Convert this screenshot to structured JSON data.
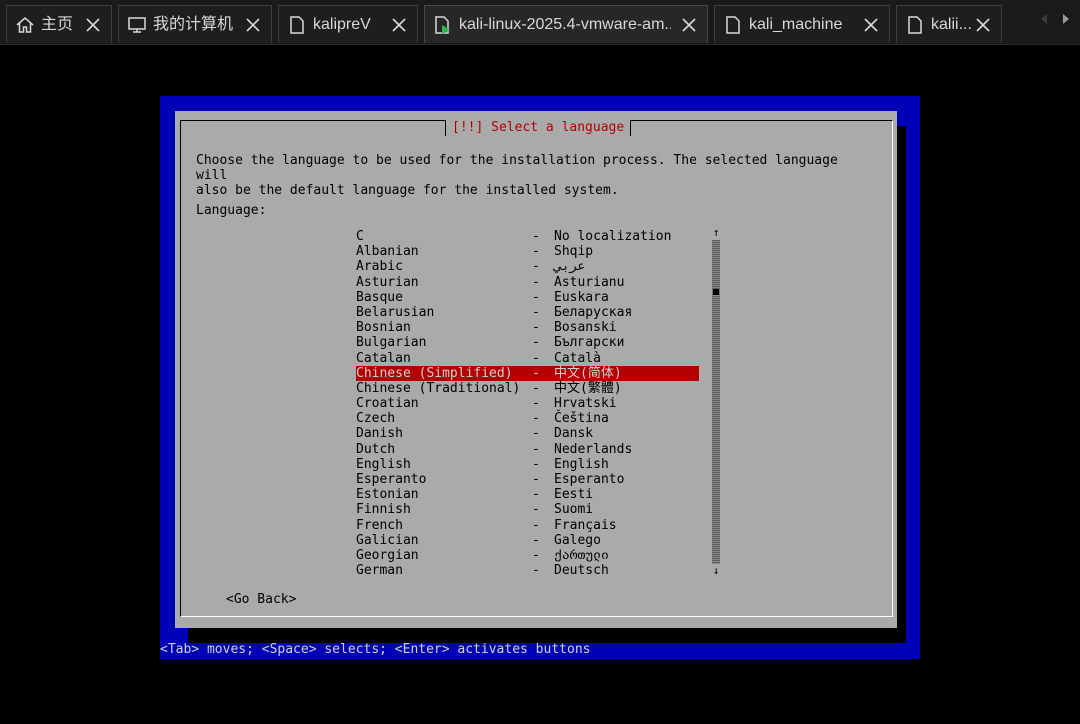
{
  "tabs": [
    {
      "label": "主页",
      "icon": "home-icon"
    },
    {
      "label": "我的计算机",
      "icon": "computer-icon"
    },
    {
      "label": "kalipreV",
      "icon": "document-icon"
    },
    {
      "label": "kali-linux-2025.4-vmware-am...",
      "icon": "vm-running-icon"
    },
    {
      "label": "kali_machine",
      "icon": "document-icon"
    },
    {
      "label": "kalii...",
      "icon": "document-icon"
    }
  ],
  "installer": {
    "title": "[!!] Select a language",
    "prompt": "Choose the language to be used for the installation process. The selected language will\nalso be the default language for the installed system.",
    "list_label": "Language:",
    "languages": [
      {
        "name": "C",
        "native": "No localization"
      },
      {
        "name": "Albanian",
        "native": "Shqip"
      },
      {
        "name": "Arabic",
        "native": "عربي"
      },
      {
        "name": "Asturian",
        "native": "Asturianu"
      },
      {
        "name": "Basque",
        "native": "Euskara"
      },
      {
        "name": "Belarusian",
        "native": "Беларуская"
      },
      {
        "name": "Bosnian",
        "native": "Bosanski"
      },
      {
        "name": "Bulgarian",
        "native": "Български"
      },
      {
        "name": "Catalan",
        "native": "Català"
      },
      {
        "name": "Chinese (Simplified)",
        "native": "中文(简体)"
      },
      {
        "name": "Chinese (Traditional)",
        "native": "中文(繁體)"
      },
      {
        "name": "Croatian",
        "native": "Hrvatski"
      },
      {
        "name": "Czech",
        "native": "Čeština"
      },
      {
        "name": "Danish",
        "native": "Dansk"
      },
      {
        "name": "Dutch",
        "native": "Nederlands"
      },
      {
        "name": "English",
        "native": "English"
      },
      {
        "name": "Esperanto",
        "native": "Esperanto"
      },
      {
        "name": "Estonian",
        "native": "Eesti"
      },
      {
        "name": "Finnish",
        "native": "Suomi"
      },
      {
        "name": "French",
        "native": "Français"
      },
      {
        "name": "Galician",
        "native": "Galego"
      },
      {
        "name": "Georgian",
        "native": "ქართული"
      },
      {
        "name": "German",
        "native": "Deutsch"
      }
    ],
    "separator": "-",
    "selected_index": 9,
    "scroll_up_glyph": "↑",
    "scroll_down_glyph": "↓",
    "go_back_label": "<Go Back>",
    "status_line": "<Tab> moves; <Space> selects; <Enter> activates buttons"
  },
  "colors": {
    "screen_bg": "#0000b8",
    "dialog_bg": "#aaaaaa",
    "title_red": "#b40000",
    "selection_bg": "#b40000"
  }
}
